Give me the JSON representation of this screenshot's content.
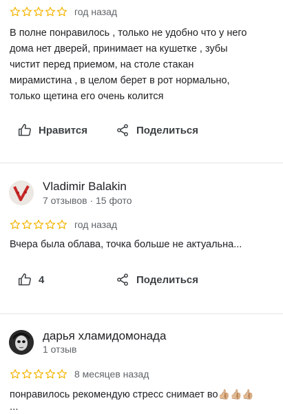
{
  "colors": {
    "star_outline": "#f4b400",
    "divider": "#e3e3e3",
    "secondary_text": "#5f6368"
  },
  "reviews": [
    {
      "time": "год назад",
      "text_lines": [
        "В полне понравилось , только не удобно что у него",
        "дома нет дверей, принимает на кушетке , зубы",
        "чистит перед приемом, на столе стакан",
        "мирамистина , в целом берет в рот нормально,",
        "только щетина его очень колится"
      ],
      "like_label": "Нравится",
      "share_label": "Поделиться"
    },
    {
      "author": "Vladimir Balakin",
      "stats": "7 отзывов · 15 фото",
      "time": "год назад",
      "text": "Вчера была облава, точка больше не актуальна...",
      "like_count": "4",
      "share_label": "Поделиться"
    },
    {
      "author": "дарья хламидомонада",
      "stats": "1 отзыв",
      "time": "8 месяцев назад",
      "text": "понравилось рекомендую стресс снимает во",
      "emojis": "👍🏼👍🏼👍🏼",
      "more": "..."
    }
  ]
}
